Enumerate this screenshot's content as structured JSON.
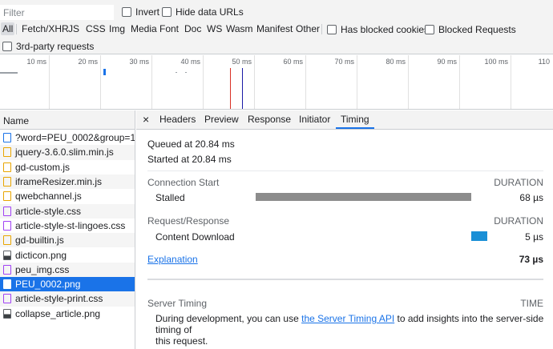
{
  "filterbar": {
    "filter_placeholder": "Filter",
    "invert_label": "Invert",
    "hide_data_urls_label": "Hide data URLs",
    "types": [
      "All",
      "Fetch/XHR",
      "JS",
      "CSS",
      "Img",
      "Media",
      "Font",
      "Doc",
      "WS",
      "Wasm",
      "Manifest",
      "Other"
    ],
    "has_blocked_cookies_label": "Has blocked cookies",
    "blocked_requests_label": "Blocked Requests",
    "third_party_label": "3rd-party requests"
  },
  "overview": {
    "ticks": [
      "10 ms",
      "20 ms",
      "30 ms",
      "40 ms",
      "50 ms",
      "60 ms",
      "70 ms",
      "80 ms",
      "90 ms",
      "100 ms",
      "110"
    ]
  },
  "requests": {
    "header": "Name",
    "items": [
      {
        "name": "?word=PEU_0002&group=1...",
        "type": "doc"
      },
      {
        "name": "jquery-3.6.0.slim.min.js",
        "type": "js"
      },
      {
        "name": "gd-custom.js",
        "type": "js"
      },
      {
        "name": "iframeResizer.min.js",
        "type": "js"
      },
      {
        "name": "qwebchannel.js",
        "type": "js"
      },
      {
        "name": "article-style.css",
        "type": "css"
      },
      {
        "name": "article-style-st-lingoes.css",
        "type": "css"
      },
      {
        "name": "gd-builtin.js",
        "type": "js"
      },
      {
        "name": "dicticon.png",
        "type": "img"
      },
      {
        "name": "peu_img.css",
        "type": "css"
      },
      {
        "name": "PEU_0002.png",
        "type": "img"
      },
      {
        "name": "article-style-print.css",
        "type": "css"
      },
      {
        "name": "collapse_article.png",
        "type": "img"
      }
    ]
  },
  "detail": {
    "tabs": [
      "Headers",
      "Preview",
      "Response",
      "Initiator",
      "Timing"
    ],
    "active_tab": "Timing",
    "queued": "Queued at 20.84 ms",
    "started": "Started at 20.84 ms",
    "connection_start": "Connection Start",
    "duration_label": "DURATION",
    "stalled_label": "Stalled",
    "stalled_value": "68 µs",
    "request_response": "Request/Response",
    "content_download_label": "Content Download",
    "content_download_value": "5 µs",
    "explanation": "Explanation",
    "total": "73 µs",
    "server_timing": "Server Timing",
    "time_label": "TIME",
    "server_text_before": "During development, you can use ",
    "server_link": "the Server Timing API",
    "server_text_after": " to add insights into the server-side timing of",
    "server_text_line2": "this request."
  },
  "colors": {
    "accent": "#1a73e8",
    "stalled_bar": "#8c8c8c",
    "download_bar": "#1a8fd6"
  }
}
